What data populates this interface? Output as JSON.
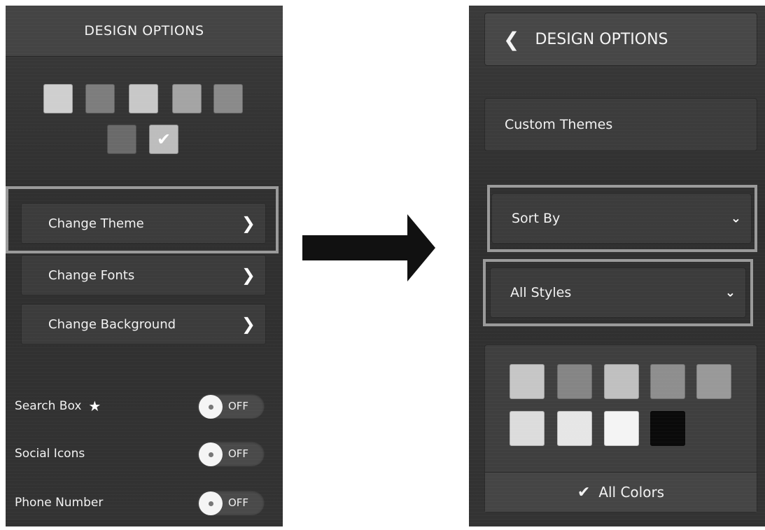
{
  "left_panel": {
    "title": "DESIGN OPTIONS",
    "theme_swatches": [
      {
        "color": "#cfcfcf",
        "selected": false
      },
      {
        "color": "#7d7d7d",
        "selected": false
      },
      {
        "color": "#c8c8c8",
        "selected": false
      },
      {
        "color": "#a4a4a4",
        "selected": false
      },
      {
        "color": "#8a8a8a",
        "selected": false
      },
      {
        "color": "#6a6a6a",
        "selected": false
      },
      {
        "color": "#bdbdbd",
        "selected": true
      }
    ],
    "selected_icon": "check-icon",
    "menu": [
      {
        "label": "Change Theme",
        "icon": "chevron-right-icon",
        "highlighted": true
      },
      {
        "label": "Change Fonts",
        "icon": "chevron-right-icon",
        "highlighted": false
      },
      {
        "label": "Change Background",
        "icon": "chevron-right-icon",
        "highlighted": false
      }
    ],
    "toggles": [
      {
        "label": "Search Box",
        "starred": true,
        "state": "OFF"
      },
      {
        "label": "Social Icons",
        "starred": false,
        "state": "OFF"
      },
      {
        "label": "Phone Number",
        "starred": false,
        "state": "OFF"
      }
    ],
    "star_icon": "star-icon"
  },
  "arrow_icon": "arrow-right-icon",
  "right_panel": {
    "back_title": "DESIGN OPTIONS",
    "back_icon": "chevron-left-icon",
    "custom_themes_label": "Custom Themes",
    "sort_by_label": "Sort By",
    "styles_label": "All Styles",
    "dropdown_icon": "chevron-down-icon",
    "color_swatches": [
      "#c6c6c6",
      "#858585",
      "#c0c0c0",
      "#8e8e8e",
      "#999999",
      "#dcdcdc",
      "#e6e6e6",
      "#f4f4f4",
      "#0a0a0a"
    ],
    "all_colors_label": "All Colors",
    "all_colors_icon": "check-icon"
  }
}
